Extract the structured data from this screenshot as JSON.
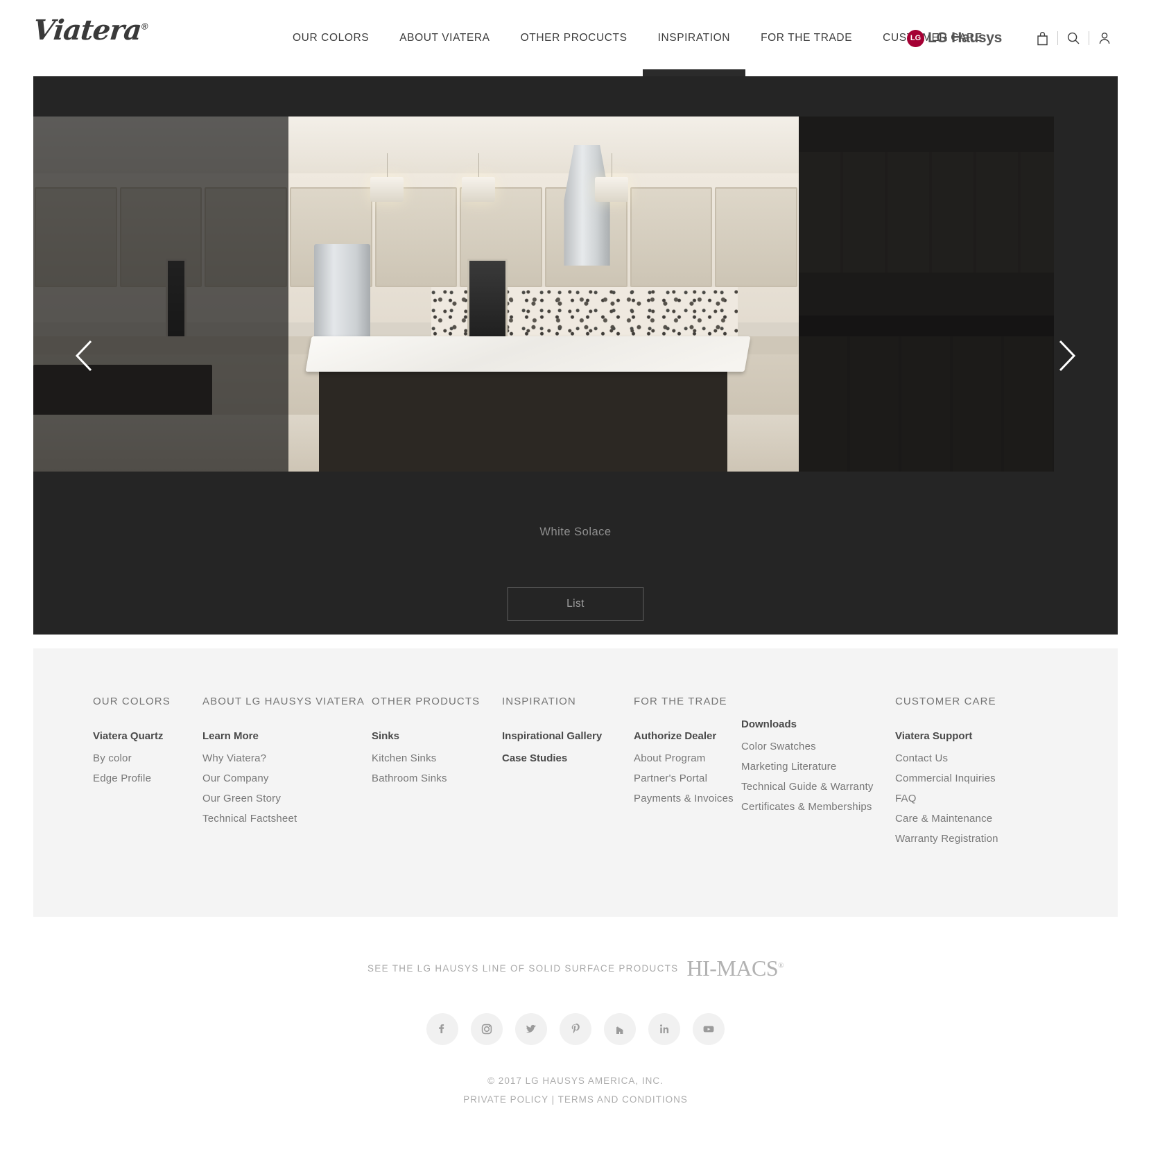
{
  "header": {
    "logo": "Viatera",
    "logo_mark": "®",
    "nav": [
      {
        "label": "OUR COLORS",
        "active": false
      },
      {
        "label": "ABOUT VIATERA",
        "active": false
      },
      {
        "label": "OTHER PROCUCTS",
        "active": false
      },
      {
        "label": "INSPIRATION",
        "active": true
      },
      {
        "label": "FOR THE TRADE",
        "active": false
      },
      {
        "label": "CUSTOMER CARE",
        "active": false
      }
    ],
    "brand": {
      "mark": "LG",
      "text": "LG Hausys"
    },
    "icons": [
      "shopping-bag-icon",
      "search-icon",
      "account-icon"
    ]
  },
  "hero": {
    "caption": "White Solace",
    "list_button": "List",
    "prev_label": "Previous slide",
    "next_label": "Next slide"
  },
  "footer": {
    "columns": [
      {
        "heading": "OUR COLORS",
        "groups": [
          {
            "title": "Viatera Quartz",
            "links": [
              "By color",
              "Edge Profile"
            ]
          }
        ]
      },
      {
        "heading": "ABOUT LG HAUSYS VIATERA",
        "groups": [
          {
            "title": "Learn More",
            "links": [
              "Why Viatera?",
              "Our Company",
              "Our Green Story",
              "Technical Factsheet"
            ]
          }
        ]
      },
      {
        "heading": "OTHER PRODUCTS",
        "groups": [
          {
            "title": "Sinks",
            "links": [
              "Kitchen Sinks",
              "Bathroom Sinks"
            ]
          }
        ]
      },
      {
        "heading": "INSPIRATION",
        "groups": [
          {
            "title": "Inspirational Gallery",
            "links": []
          },
          {
            "title": "Case Studies",
            "links": []
          }
        ]
      },
      {
        "heading": "FOR THE TRADE",
        "groups": [
          {
            "title": "Authorize Dealer",
            "links": [
              "About Program",
              "Partner's Portal",
              "Payments & Invoices"
            ]
          }
        ]
      },
      {
        "heading": "",
        "groups": [
          {
            "title": "Downloads",
            "links": [
              "Color Swatches",
              "Marketing Literature",
              "Technical Guide & Warranty",
              "Certificates & Memberships"
            ]
          }
        ]
      },
      {
        "heading": "CUSTOMER CARE",
        "groups": [
          {
            "title": "Viatera Support",
            "links": [
              "Contact Us",
              "Commercial Inquiries",
              "FAQ",
              "Care & Maintenance",
              "Warranty Registration"
            ]
          }
        ]
      }
    ]
  },
  "bottom": {
    "himacs_text": "SEE THE LG HAUSYS LINE OF SOLID SURFACE PRODUCTS",
    "himacs_logo": "HI-MACS",
    "himacs_mark": "®",
    "social": [
      "facebook-icon",
      "instagram-icon",
      "twitter-icon",
      "pinterest-icon",
      "houzz-icon",
      "linkedin-icon",
      "youtube-icon"
    ],
    "copyright": "© 2017 LG HAUSYS AMERICA, INC.",
    "privacy": "PRIVATE POLICY",
    "separator": " | ",
    "terms": "TERMS AND CONDITIONS"
  },
  "colors": {
    "brand_red": "#a50034",
    "hero_bg": "#252525",
    "footer_bg": "#f4f4f4"
  }
}
